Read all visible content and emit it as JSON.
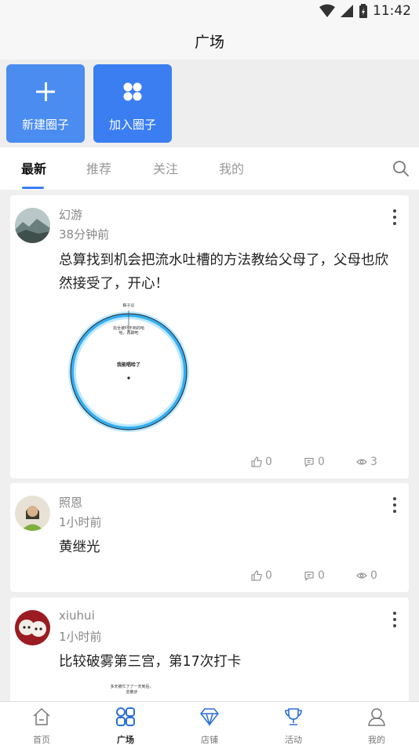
{
  "status_bar": {
    "time": "11:42"
  },
  "header": {
    "title": "广场"
  },
  "actions": [
    {
      "label": "新建圈子",
      "icon": "plus-icon"
    },
    {
      "label": "加入圈子",
      "icon": "circles-icon"
    }
  ],
  "tabs": [
    {
      "label": "最新",
      "active": true
    },
    {
      "label": "推荐",
      "active": false
    },
    {
      "label": "关注",
      "active": false
    },
    {
      "label": "我的",
      "active": false
    }
  ],
  "posts": [
    {
      "author": "幻游",
      "time": "38分钟前",
      "content": "总算找到机会把流水吐槽的方法教给父母了，父母也欣然接受了，开心！",
      "image_texts": [
        "粽子瓜",
        "完全被吓不到的哈哈，再聊吧",
        "我能唱哈了"
      ],
      "likes": "0",
      "comments": "0",
      "views": "3"
    },
    {
      "author": "照恩",
      "time": "1小时前",
      "content": "黄继光",
      "likes": "0",
      "comments": "0",
      "views": "0"
    },
    {
      "author": "xiuhui",
      "time": "1小时前",
      "content": "比较破雾第三宫，第17次打卡",
      "image_texts": [
        "多天被忙了了一天到后，",
        "去散步"
      ]
    }
  ],
  "bottom_nav": [
    {
      "label": "首页",
      "icon": "home-icon",
      "active": false
    },
    {
      "label": "广场",
      "icon": "square-icon",
      "active": true
    },
    {
      "label": "店铺",
      "icon": "diamond-icon",
      "active": false
    },
    {
      "label": "活动",
      "icon": "trophy-icon",
      "active": false
    },
    {
      "label": "我的",
      "icon": "profile-icon",
      "active": false
    }
  ],
  "colors": {
    "accent": "#3a7ef2",
    "card_new": "#4a8cf0",
    "ring_glow": "#3ab4f2"
  }
}
